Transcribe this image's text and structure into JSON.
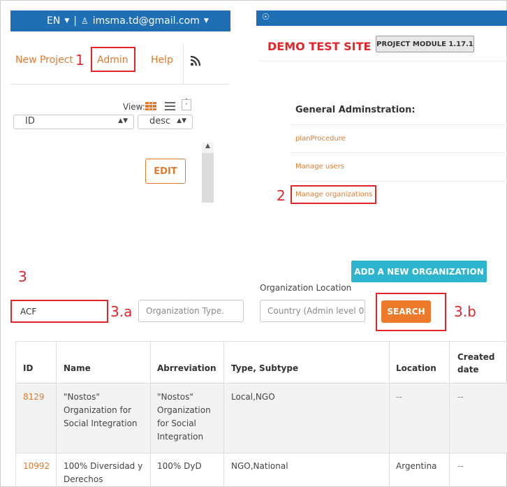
{
  "userbar": {
    "language": "EN",
    "email": "imsma.td@gmail.com"
  },
  "header": {
    "site_title": "DEMO TEST SITE",
    "module_badge": "PROJECT MODULE 1.17.1"
  },
  "nav": {
    "new_project": "New Project",
    "admin": "Admin",
    "help": "Help"
  },
  "annotations": {
    "n1": "1",
    "n2": "2",
    "n3": "3",
    "n3a": "3.a",
    "n3b": "3.b"
  },
  "left_panel": {
    "view_label": "View:",
    "sort_field": "ID",
    "sort_order": "desc",
    "edit_label": "EDIT"
  },
  "admin": {
    "title": "General Adminstration:",
    "links": [
      "planProcedure",
      "Manage users",
      "Manage organizations"
    ]
  },
  "search": {
    "add_button": "ADD A NEW ORGANIZATION",
    "location_label": "Organization Location",
    "name_value": "ACF",
    "type_placeholder": "Organization Type.",
    "country_placeholder": "Country (Admin level 0",
    "search_button": "SEARCH"
  },
  "table": {
    "headers": [
      "ID",
      "Name",
      "Abrreviation",
      "Type, Subtype",
      "Location",
      "Created date"
    ],
    "rows": [
      {
        "id": "8129",
        "name": "\"Nostos\" Organization for Social Integration",
        "abbr": "\"Nostos\" Organization for Social Integration",
        "type": "Local,NGO",
        "location": "--",
        "created": "--"
      },
      {
        "id": "10992",
        "name": "100% Diversidad y Derechos",
        "abbr": "100% DyD",
        "type": "NGO,National",
        "location": "Argentina",
        "created": "--"
      }
    ]
  },
  "colors": {
    "blue": "#1f6fb5",
    "orange": "#e07a2d",
    "red": "#e3262a",
    "teal": "#2db4cf"
  }
}
